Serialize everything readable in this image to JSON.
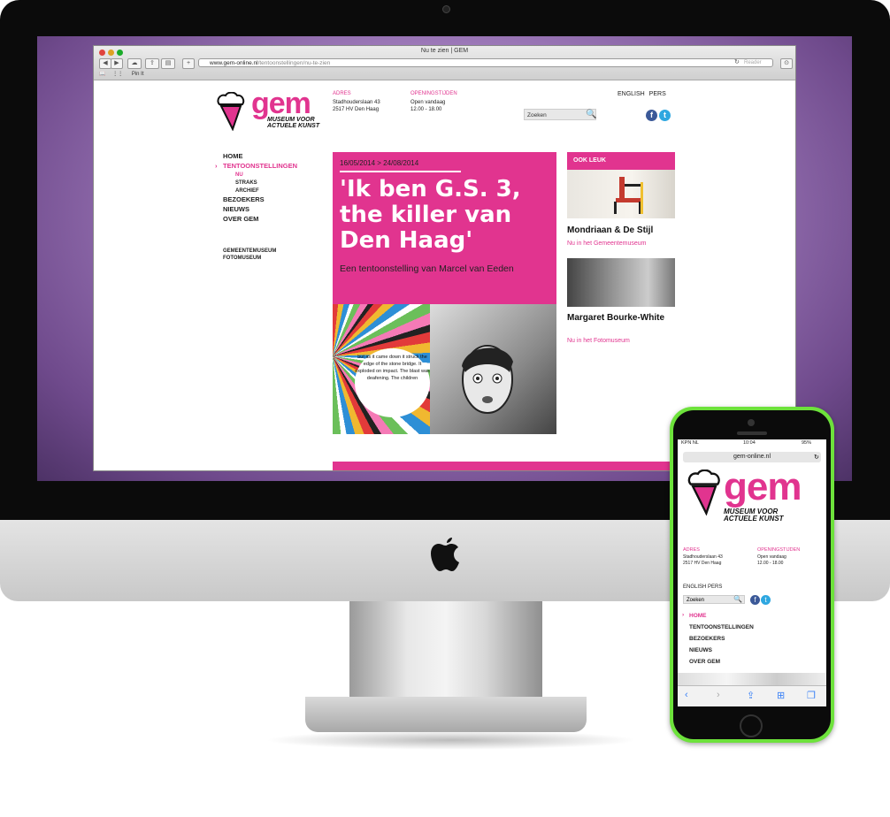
{
  "browser": {
    "window_title": "Nu te zien | GEM",
    "url_host": "www.gem-online.nl",
    "url_path": "/tentoonstellingen/nu-te-zien",
    "reader": "Reader",
    "bookmark": "Pin It"
  },
  "site": {
    "logo": "gem",
    "logo_sub1": "MUSEUM VOOR",
    "logo_sub2": "ACTUELE KUNST",
    "adres_label": "ADRES",
    "adres_line1": "Stadhouderslaan 43",
    "adres_line2": "2517 HV Den Haag",
    "open_label": "OPENINGSTIJDEN",
    "open_line1": "Open vandaag",
    "open_line2": "12.00 - 18.00",
    "lang_links": "ENGLISH  PERS",
    "search_placeholder": "Zoeken",
    "nav": {
      "home": "HOME",
      "tentoonstellingen": "TENTOONSTELLINGEN",
      "nu": "NU",
      "straks": "STRAKS",
      "archief": "ARCHIEF",
      "bezoekers": "BEZOEKERS",
      "nieuws": "NIEUWS",
      "over_gem": "OVER GEM",
      "gemeentemuseum": "GEMEENTEMUSEUM",
      "fotomuseum": "FOTOMUSEUM"
    },
    "feature": {
      "dates": "16/05/2014 > 24/08/2014",
      "title": "'Ik ben G.S. 3, the killer van Den Haag'",
      "subtitle": "Een tentoonstelling van Marcel van Eeden",
      "bubble": "but as it came down it struck the edge of the stone bridge. It exploded on impact. The blast was deafening. The children"
    },
    "ook_leuk": {
      "header": "OOK LEUK",
      "items": [
        {
          "title": "Mondriaan & De Stijl",
          "link": "Nu in het Gemeentemuseum"
        },
        {
          "title": "Margaret Bourke-White",
          "link": "Nu in het Fotomuseum"
        }
      ]
    }
  },
  "phone": {
    "carrier": "KPN NL",
    "time": "10:04",
    "battery": "95%",
    "url": "gem-online.nl",
    "logo": "gem",
    "logo_sub1": "MUSEUM VOOR",
    "logo_sub2": "ACTUELE KUNST",
    "adres_label": "ADRES",
    "adres_line1": "Stadhouderslaan 43",
    "adres_line2": "2517 HV Den Haag",
    "open_label": "OPENINGSTIJDEN",
    "open_line1": "Open vandaag",
    "open_line2": "12.00 - 18.00",
    "lang_links": "ENGLISH  PERS",
    "search_placeholder": "Zoeken",
    "nav": [
      "HOME",
      "TENTOONSTELLINGEN",
      "BEZOEKERS",
      "NIEUWS",
      "OVER GEM"
    ]
  },
  "colors": {
    "accent": "#e1348f",
    "phone_body": "#6de23b",
    "facebook": "#3b5998",
    "twitter": "#2ea7e0"
  }
}
